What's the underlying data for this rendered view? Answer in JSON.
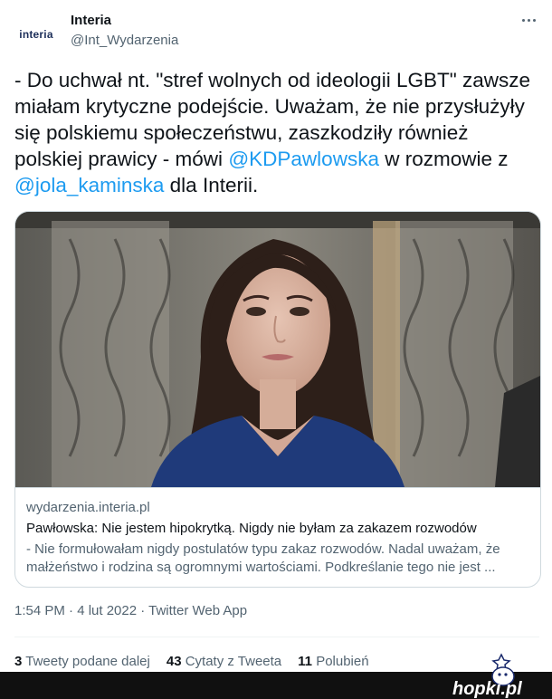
{
  "account": {
    "avatar_text": "interia",
    "name": "Interia",
    "handle": "@Int_Wydarzenia"
  },
  "tweet": {
    "text_parts": {
      "p1": "- Do uchwał nt. \"stref wolnych od ideologii LGBT\" zawsze miałam krytyczne podejście. Uważam, że nie przysłużyły się polskiemu społeczeństwu, zaszkodziły również polskiej prawicy - mówi ",
      "mention1": "@KDPawlowska",
      "p2": " w rozmowie z ",
      "mention2": "@jola_kaminska",
      "p3": " dla Interii."
    }
  },
  "card": {
    "domain": "wydarzenia.interia.pl",
    "title": "Pawłowska: Nie jestem hipokrytką. Nigdy nie byłam za zakazem rozwodów",
    "description": "- Nie formułowałam nigdy postulatów typu zakaz rozwodów. Nadal uważam, że małżeństwo i rodzina są ogromnymi wartościami. Podkreślanie tego nie jest ..."
  },
  "meta": {
    "timestamp": "1:54 PM · 4 lut 2022 · Twitter Web App"
  },
  "stats": {
    "retweets_count": "3",
    "retweets_label": "Tweety podane dalej",
    "quotes_count": "43",
    "quotes_label": "Cytaty z Tweeta",
    "likes_count": "11",
    "likes_label": "Polubień"
  },
  "watermark": {
    "text": "hopki.pl"
  },
  "colors": {
    "link": "#1d9bf0",
    "secondary": "#536471",
    "primary_text": "#0f1419",
    "border": "#cfd9de"
  },
  "icons": {
    "more": "more-horizontal-icon"
  }
}
